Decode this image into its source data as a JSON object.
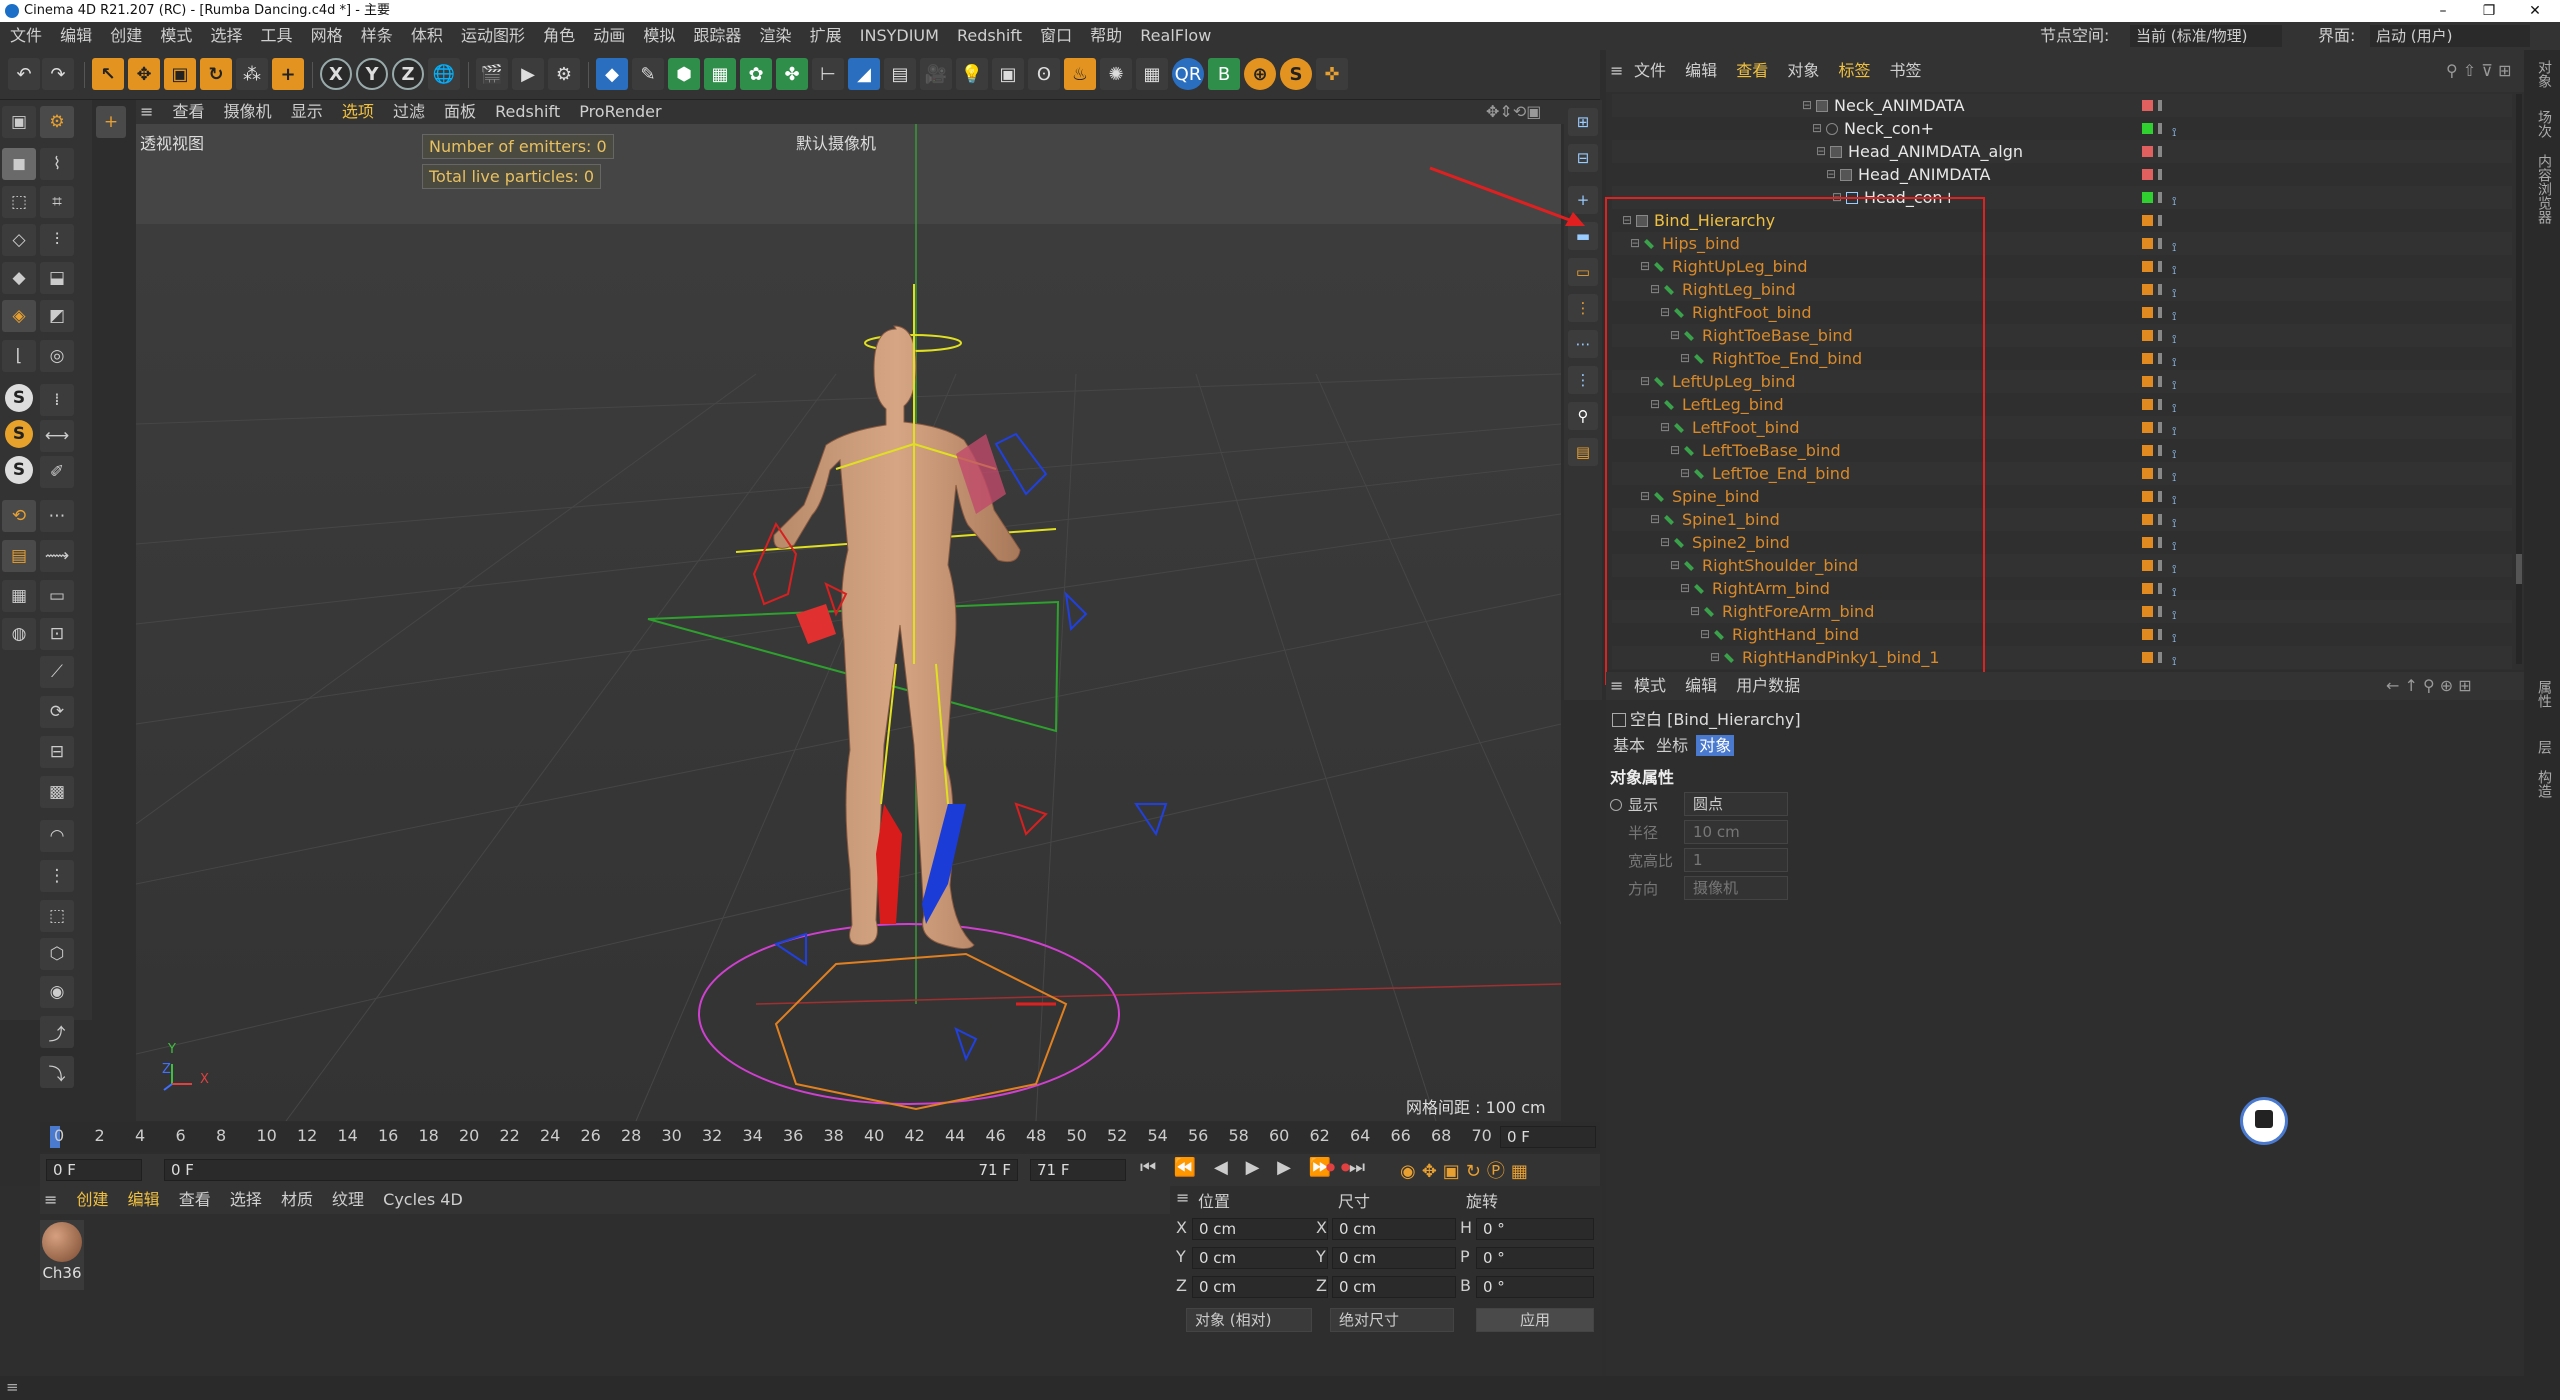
{
  "window": {
    "title": "Cinema 4D R21.207 (RC) - [Rumba Dancing.c4d *] - 主要"
  },
  "menu": {
    "items": [
      "文件",
      "编辑",
      "创建",
      "模式",
      "选择",
      "工具",
      "网格",
      "样条",
      "体积",
      "运动图形",
      "角色",
      "动画",
      "模拟",
      "跟踪器",
      "渲染",
      "扩展",
      "INSYDIUM",
      "Redshift",
      "窗口",
      "帮助",
      "RealFlow"
    ],
    "node_space_label": "节点空间:",
    "node_space_value": "当前 (标准/物理)",
    "layout_label": "界面:",
    "layout_value": "启动 (用户)"
  },
  "toolbar": {
    "x": "X",
    "y": "Y",
    "z": "Z",
    "qr": "QR",
    "s": "S"
  },
  "lefttools": {
    "s1": "S",
    "s2": "S",
    "s3": "S"
  },
  "viewport": {
    "menu": [
      "查看",
      "摄像机",
      "显示",
      "选项",
      "过滤",
      "面板",
      "Redshift",
      "ProRender"
    ],
    "name": "透视视图",
    "camera": "默认摄像机",
    "hud_emitters": "Number of emitters: 0",
    "hud_particles": "Total live particles: 0",
    "grid": "网格间距 : 100 cm",
    "axis_x": "X",
    "axis_y": "Y",
    "axis_z": "Z"
  },
  "timeline": {
    "ticks": [
      "0",
      "2",
      "4",
      "6",
      "8",
      "10",
      "12",
      "14",
      "16",
      "18",
      "20",
      "22",
      "24",
      "26",
      "28",
      "30",
      "32",
      "34",
      "36",
      "38",
      "40",
      "42",
      "44",
      "46",
      "48",
      "50",
      "52",
      "54",
      "56",
      "58",
      "60",
      "62",
      "64",
      "66",
      "68",
      "70"
    ],
    "current_frame": "0 F"
  },
  "playbar": {
    "start": "0 F",
    "range_start": "0 F",
    "range_end": "71 F",
    "end": "71 F"
  },
  "materials": {
    "menu": [
      "创建",
      "编辑",
      "查看",
      "选择",
      "材质",
      "纹理",
      "Cycles 4D"
    ],
    "items": [
      {
        "name": "Ch36"
      }
    ]
  },
  "coords": {
    "headers": [
      "位置",
      "尺寸",
      "旋转"
    ],
    "rows": [
      {
        "axis": "X",
        "pos": "0 cm",
        "saxis": "X",
        "size": "0 cm",
        "raxis": "H",
        "rot": "0 °"
      },
      {
        "axis": "Y",
        "pos": "0 cm",
        "saxis": "Y",
        "size": "0 cm",
        "raxis": "P",
        "rot": "0 °"
      },
      {
        "axis": "Z",
        "pos": "0 cm",
        "saxis": "Z",
        "size": "0 cm",
        "raxis": "B",
        "rot": "0 °"
      }
    ],
    "mode": "对象 (相对)",
    "size_mode": "绝对尺寸",
    "apply": "应用"
  },
  "objects": {
    "menu": [
      "文件",
      "编辑",
      "查看",
      "对象",
      "标签",
      "书签"
    ],
    "rows": [
      {
        "name": "Neck_ANIMDATA",
        "color": "#e8e8e8",
        "icon": "null"
      },
      {
        "name": "Neck_con+",
        "color": "#e8e8e8",
        "icon": "circle"
      },
      {
        "name": "Head_ANIMDATA_algn",
        "color": "#e8e8e8",
        "icon": "null"
      },
      {
        "name": "Head_ANIMDATA",
        "color": "#e8e8e8",
        "icon": "null"
      },
      {
        "name": "Head_con+",
        "color": "#e8e8e8",
        "icon": "spline"
      },
      {
        "name": "Bind_Hierarchy",
        "color": "#f0c040",
        "icon": "null"
      },
      {
        "name": "Hips_bind",
        "color": "#d88a2a",
        "icon": "joint"
      },
      {
        "name": "RightUpLeg_bind",
        "color": "#d88a2a",
        "icon": "joint"
      },
      {
        "name": "RightLeg_bind",
        "color": "#d88a2a",
        "icon": "joint"
      },
      {
        "name": "RightFoot_bind",
        "color": "#d88a2a",
        "icon": "joint"
      },
      {
        "name": "RightToeBase_bind",
        "color": "#d88a2a",
        "icon": "joint"
      },
      {
        "name": "RightToe_End_bind",
        "color": "#d88a2a",
        "icon": "joint"
      },
      {
        "name": "LeftUpLeg_bind",
        "color": "#d88a2a",
        "icon": "joint"
      },
      {
        "name": "LeftLeg_bind",
        "color": "#d88a2a",
        "icon": "joint"
      },
      {
        "name": "LeftFoot_bind",
        "color": "#d88a2a",
        "icon": "joint"
      },
      {
        "name": "LeftToeBase_bind",
        "color": "#d88a2a",
        "icon": "joint"
      },
      {
        "name": "LeftToe_End_bind",
        "color": "#d88a2a",
        "icon": "joint"
      },
      {
        "name": "Spine_bind",
        "color": "#d88a2a",
        "icon": "joint"
      },
      {
        "name": "Spine1_bind",
        "color": "#d88a2a",
        "icon": "joint"
      },
      {
        "name": "Spine2_bind",
        "color": "#d88a2a",
        "icon": "joint"
      },
      {
        "name": "RightShoulder_bind",
        "color": "#d88a2a",
        "icon": "joint"
      },
      {
        "name": "RightArm_bind",
        "color": "#d88a2a",
        "icon": "joint"
      },
      {
        "name": "RightForeArm_bind",
        "color": "#d88a2a",
        "icon": "joint"
      },
      {
        "name": "RightHand_bind",
        "color": "#d88a2a",
        "icon": "joint"
      },
      {
        "name": "RightHandPinky1_bind_1",
        "color": "#d88a2a",
        "icon": "joint"
      }
    ]
  },
  "attributes": {
    "menu": [
      "模式",
      "编辑",
      "用户数据"
    ],
    "title": "空白 [Bind_Hierarchy]",
    "tabs": [
      "基本",
      "坐标",
      "对象"
    ],
    "section": "对象属性",
    "display_label": "显示",
    "display_value": "圆点",
    "radius_label": "半径",
    "radius_value": "10 cm",
    "aspect_label": "宽高比",
    "aspect_value": "1",
    "orientation_label": "方向",
    "orientation_value": "摄像机"
  },
  "rightstrip": {
    "t1": "对象",
    "t2": "场次",
    "t3": "内容浏览器",
    "t4": "属性",
    "t5": "层",
    "t6": "构造"
  }
}
